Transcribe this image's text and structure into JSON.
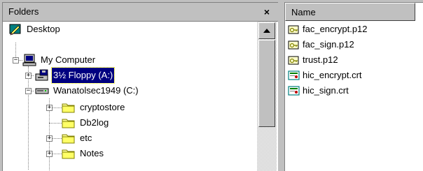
{
  "folders_pane": {
    "title": "Folders",
    "close_label": "×",
    "tree": [
      {
        "label": "Desktop",
        "icon": "desktop-icon"
      },
      {
        "label": "My Computer",
        "icon": "computer-icon",
        "expander": "−"
      },
      {
        "label": "3½ Floppy (A:)",
        "icon": "floppy-drive-icon",
        "expander": "+",
        "selected": true
      },
      {
        "label": "Wanatolsec1949 (C:)",
        "icon": "hard-drive-icon",
        "expander": "−"
      },
      {
        "label": "cryptostore",
        "icon": "folder-icon",
        "expander": "+"
      },
      {
        "label": "Db2log",
        "icon": "folder-icon"
      },
      {
        "label": "etc",
        "icon": "folder-icon",
        "expander": "+"
      },
      {
        "label": "Notes",
        "icon": "folder-icon",
        "expander": "+"
      }
    ]
  },
  "files_pane": {
    "column_header": "Name",
    "files": [
      {
        "name": "fac_encrypt.p12",
        "icon": "pkcs12-file-icon"
      },
      {
        "name": "fac_sign.p12",
        "icon": "pkcs12-file-icon"
      },
      {
        "name": "trust.p12",
        "icon": "pkcs12-file-icon"
      },
      {
        "name": "hic_encrypt.crt",
        "icon": "certificate-file-icon"
      },
      {
        "name": "hic_sign.crt",
        "icon": "certificate-file-icon"
      }
    ]
  },
  "colors": {
    "selection_bg": "#000080",
    "selection_fg": "#ffffff",
    "chrome": "#c0c0c0",
    "folder_yellow": "#ffff99"
  }
}
